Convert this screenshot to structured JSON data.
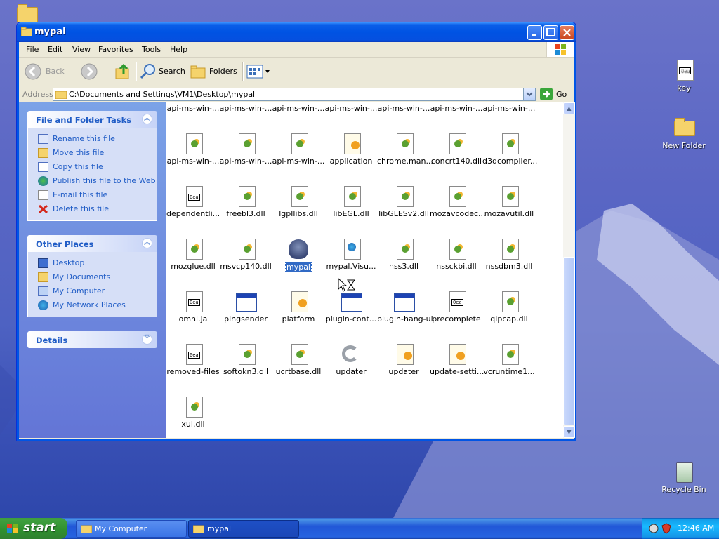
{
  "window": {
    "title": "mypal",
    "menu": [
      "File",
      "Edit",
      "View",
      "Favorites",
      "Tools",
      "Help"
    ],
    "toolbar": {
      "back": "Back",
      "search": "Search",
      "folders": "Folders"
    },
    "address": {
      "label": "Address",
      "value": "C:\\Documents and Settings\\VM1\\Desktop\\mypal",
      "go": "Go"
    }
  },
  "leftpane": {
    "file_tasks": {
      "title": "File and Folder Tasks",
      "items": [
        "Rename this file",
        "Move this file",
        "Copy this file",
        "Publish this file to the Web",
        "E-mail this file",
        "Delete this file"
      ]
    },
    "other_places": {
      "title": "Other Places",
      "items": [
        "Desktop",
        "My Documents",
        "My Computer",
        "My Network Places"
      ]
    },
    "details": {
      "title": "Details"
    }
  },
  "files": [
    {
      "label": "api-ms-win-...",
      "type": "dll"
    },
    {
      "label": "api-ms-win-...",
      "type": "dll"
    },
    {
      "label": "api-ms-win-...",
      "type": "dll"
    },
    {
      "label": "api-ms-win-...",
      "type": "dll"
    },
    {
      "label": "api-ms-win-...",
      "type": "dll"
    },
    {
      "label": "api-ms-win-...",
      "type": "dll"
    },
    {
      "label": "api-ms-win-...",
      "type": "dll"
    },
    {
      "label": "api-ms-win-...",
      "type": "dll"
    },
    {
      "label": "api-ms-win-...",
      "type": "dll"
    },
    {
      "label": "api-ms-win-...",
      "type": "dll"
    },
    {
      "label": "application",
      "type": "cfg"
    },
    {
      "label": "chrome.man...",
      "type": "dll"
    },
    {
      "label": "concrt140.dll",
      "type": "dll"
    },
    {
      "label": "d3dcompiler...",
      "type": "dll"
    },
    {
      "label": "dependentli...",
      "type": "txt"
    },
    {
      "label": "freebl3.dll",
      "type": "dll"
    },
    {
      "label": "lgpllibs.dll",
      "type": "dll"
    },
    {
      "label": "libEGL.dll",
      "type": "dll"
    },
    {
      "label": "libGLESv2.dll",
      "type": "dll"
    },
    {
      "label": "mozavcodec...",
      "type": "dll"
    },
    {
      "label": "mozavutil.dll",
      "type": "dll"
    },
    {
      "label": "mozglue.dll",
      "type": "dll"
    },
    {
      "label": "msvcp140.dll",
      "type": "dll"
    },
    {
      "label": "mypal",
      "type": "pal",
      "selected": true
    },
    {
      "label": "mypal.Visu...",
      "type": "globe"
    },
    {
      "label": "nss3.dll",
      "type": "dll"
    },
    {
      "label": "nssckbi.dll",
      "type": "dll"
    },
    {
      "label": "nssdbm3.dll",
      "type": "dll"
    },
    {
      "label": "omni.ja",
      "type": "txt"
    },
    {
      "label": "pingsender",
      "type": "exe"
    },
    {
      "label": "platform",
      "type": "cfg"
    },
    {
      "label": "plugin-cont...",
      "type": "exe"
    },
    {
      "label": "plugin-hang-ui",
      "type": "exe"
    },
    {
      "label": "precomplete",
      "type": "txt"
    },
    {
      "label": "qipcap.dll",
      "type": "dll"
    },
    {
      "label": "removed-files",
      "type": "txt"
    },
    {
      "label": "softokn3.dll",
      "type": "dll"
    },
    {
      "label": "ucrtbase.dll",
      "type": "dll"
    },
    {
      "label": "updater",
      "type": "updater"
    },
    {
      "label": "updater",
      "type": "cfg"
    },
    {
      "label": "update-setti...",
      "type": "cfg"
    },
    {
      "label": "vcruntime1...",
      "type": "dll"
    },
    {
      "label": "xul.dll",
      "type": "dll"
    }
  ],
  "desktop": {
    "icons": [
      "key",
      "New Folder",
      "Recycle Bin"
    ]
  },
  "taskbar": {
    "start": "start",
    "buttons": [
      "My Computer",
      "mypal"
    ],
    "clock": "12:46 AM"
  }
}
